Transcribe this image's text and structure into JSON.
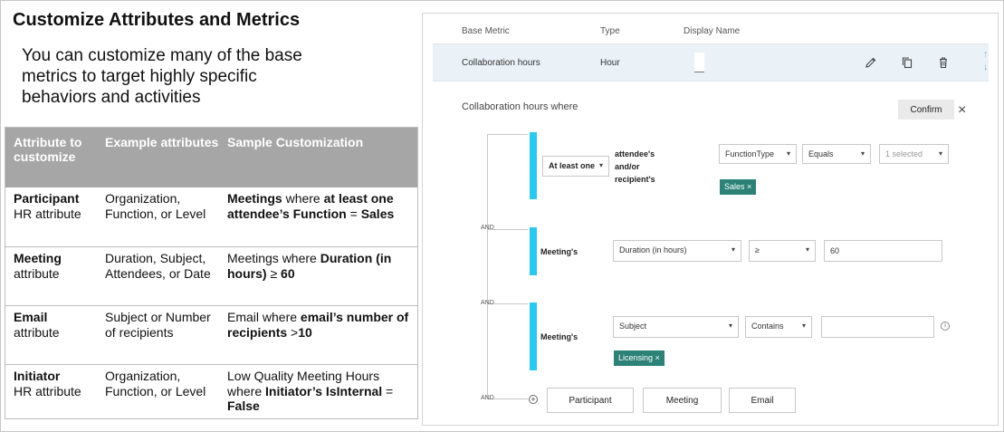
{
  "title": "Customize Attributes and Metrics",
  "intro": "You can customize many of the base metrics to target highly specific behaviors and activities",
  "table": {
    "headers": [
      "Attribute to customize",
      "Example attributes",
      "Sample Customization"
    ],
    "rows": [
      {
        "attr_bold": "Participant",
        "attr_rest": "HR attribute",
        "examples": "Organization, Function, or Level",
        "sample": [
          {
            "t": "Meetings",
            "b": true
          },
          {
            "t": " where ",
            "b": false
          },
          {
            "t": "at least one attendee’s Function",
            "b": true
          },
          {
            "t": " = ",
            "b": false
          },
          {
            "t": "Sales",
            "b": true
          }
        ]
      },
      {
        "attr_bold": "Meeting",
        "attr_rest": "attribute",
        "examples": "Duration, Subject, Attendees, or Date",
        "sample": [
          {
            "t": "Meetings where ",
            "b": false
          },
          {
            "t": "Duration (in hours)",
            "b": true
          },
          {
            "t": " ≥ ",
            "b": false
          },
          {
            "t": "60",
            "b": true
          }
        ]
      },
      {
        "attr_bold": "Email",
        "attr_rest": "attribute",
        "examples": "Subject or Number of recipients",
        "sample": [
          {
            "t": "Email where ",
            "b": false
          },
          {
            "t": "email’s number of recipients",
            "b": true
          },
          {
            "t": " >",
            "b": false
          },
          {
            "t": "10",
            "b": true
          }
        ]
      },
      {
        "attr_bold": "Initiator",
        "attr_rest": "HR attribute",
        "examples": "Organization, Function, or Level",
        "sample": [
          {
            "t": "Low Quality Meeting Hours where ",
            "b": false
          },
          {
            "t": "Initiator’s IsInternal",
            "b": true
          },
          {
            "t": " = ",
            "b": false
          },
          {
            "t": "False",
            "b": true
          }
        ]
      }
    ]
  },
  "editor": {
    "col_headers": {
      "base_metric": "Base Metric",
      "type": "Type",
      "display_name": "Display Name"
    },
    "metric_row": {
      "base_metric": "Collaboration hours",
      "type": "Hour",
      "display_name": ""
    },
    "where_label": "Collaboration hours where",
    "confirm_label": "Confirm",
    "and_label": "AND",
    "conditions": {
      "c1": {
        "quantifier": "At least one",
        "label": "attendee's and/or recipient's",
        "field": "FunctionType",
        "operator": "Equals",
        "value_placeholder": "1 selected",
        "tag": "Sales"
      },
      "c2": {
        "label": "Meeting's",
        "field": "Duration (in hours)",
        "operator": "≥",
        "value": "60"
      },
      "c3": {
        "label": "Meeting's",
        "field": "Subject",
        "operator": "Contains",
        "value": "",
        "tag": "Licensing"
      }
    },
    "add_buttons": [
      "Participant",
      "Meeting",
      "Email"
    ]
  },
  "colors": {
    "header_bg": "#a6a6a6",
    "accent_cyan": "#2bc8ef",
    "tag_teal": "#2c8277",
    "metric_row_bg": "#eaf2f8"
  }
}
